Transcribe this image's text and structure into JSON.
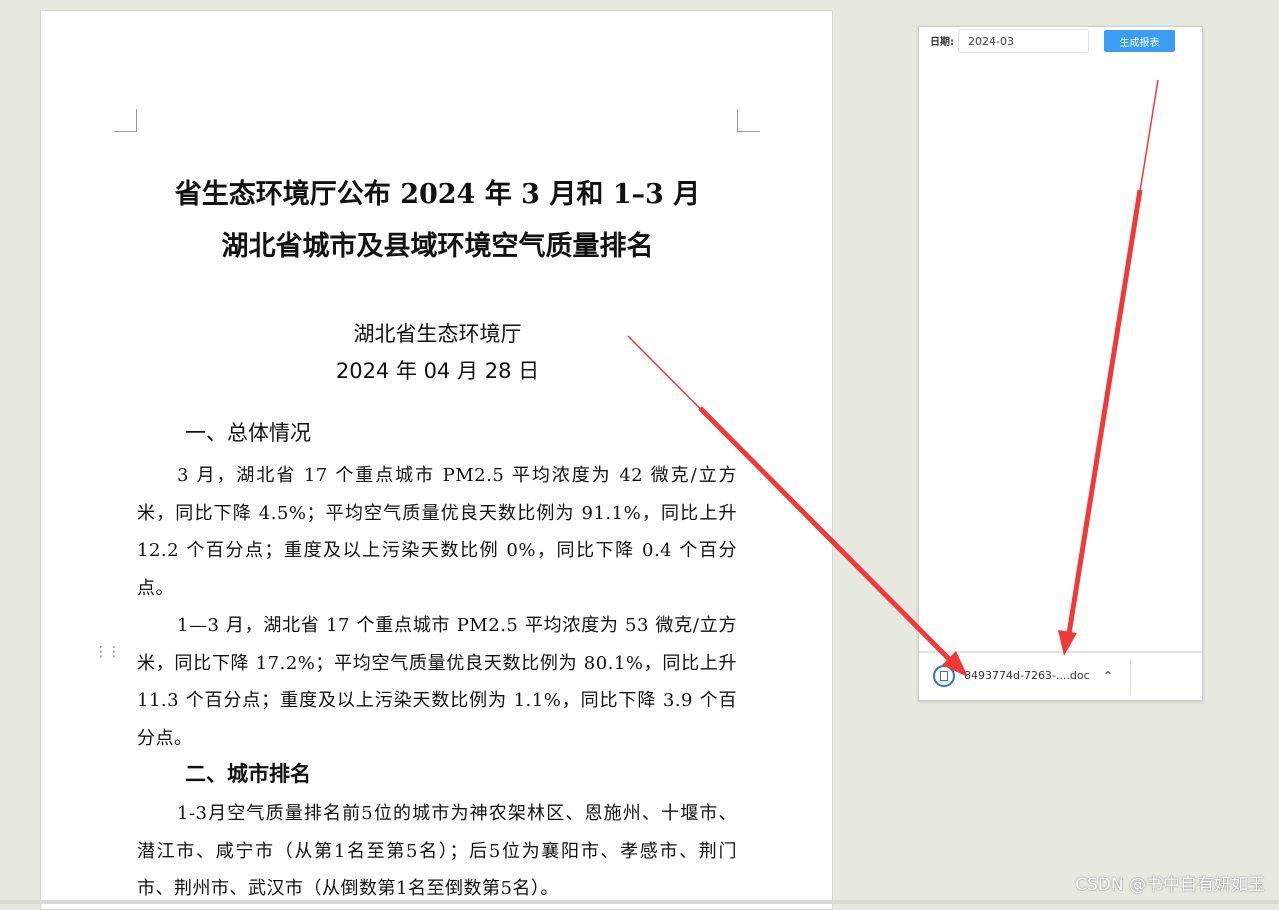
{
  "document": {
    "title_line1": "省生态环境厅公布 2024 年 3 月和 1–3 月",
    "title_line2": "湖北省城市及县域环境空气质量排名",
    "issuer": "湖北省生态环境厅",
    "date": "2024 年 04 月 28 日",
    "section1_heading": "一、总体情况",
    "para1": "3 月，湖北省 17 个重点城市 PM2.5 平均浓度为 42 微克/立方米，同比下降 4.5%；平均空气质量优良天数比例为 91.1%，同比上升 12.2 个百分点；重度及以上污染天数比例 0%，同比下降 0.4 个百分点。",
    "para2": "1—3 月，湖北省 17 个重点城市 PM2.5 平均浓度为 53 微克/立方米，同比下降 17.2%；平均空气质量优良天数比例为 80.1%，同比上升 11.3 个百分点；重度及以上污染天数比例为 1.1%，同比下降 3.9 个百分点。",
    "section2_heading": "二、城市排名",
    "para3": "1-3月空气质量排名前5位的城市为神农架林区、恩施州、十堰市、潜江市、咸宁市（从第1名至第5名）；后5位为襄阳市、孝感市、荆门市、荆州市、武汉市（从倒数第1名至倒数第5名）。"
  },
  "form": {
    "date_label": "日期:",
    "date_value": "2024-03",
    "generate_button": "生成报表"
  },
  "download_bar": {
    "file_name": "8493774d-7263-....doc",
    "chevron": "^"
  },
  "watermark": "CSDN @书中自有妍如玉",
  "colors": {
    "arrow": "#f03a3a",
    "button": "#3a9ef5",
    "file_icon": "#2a6fdb"
  }
}
